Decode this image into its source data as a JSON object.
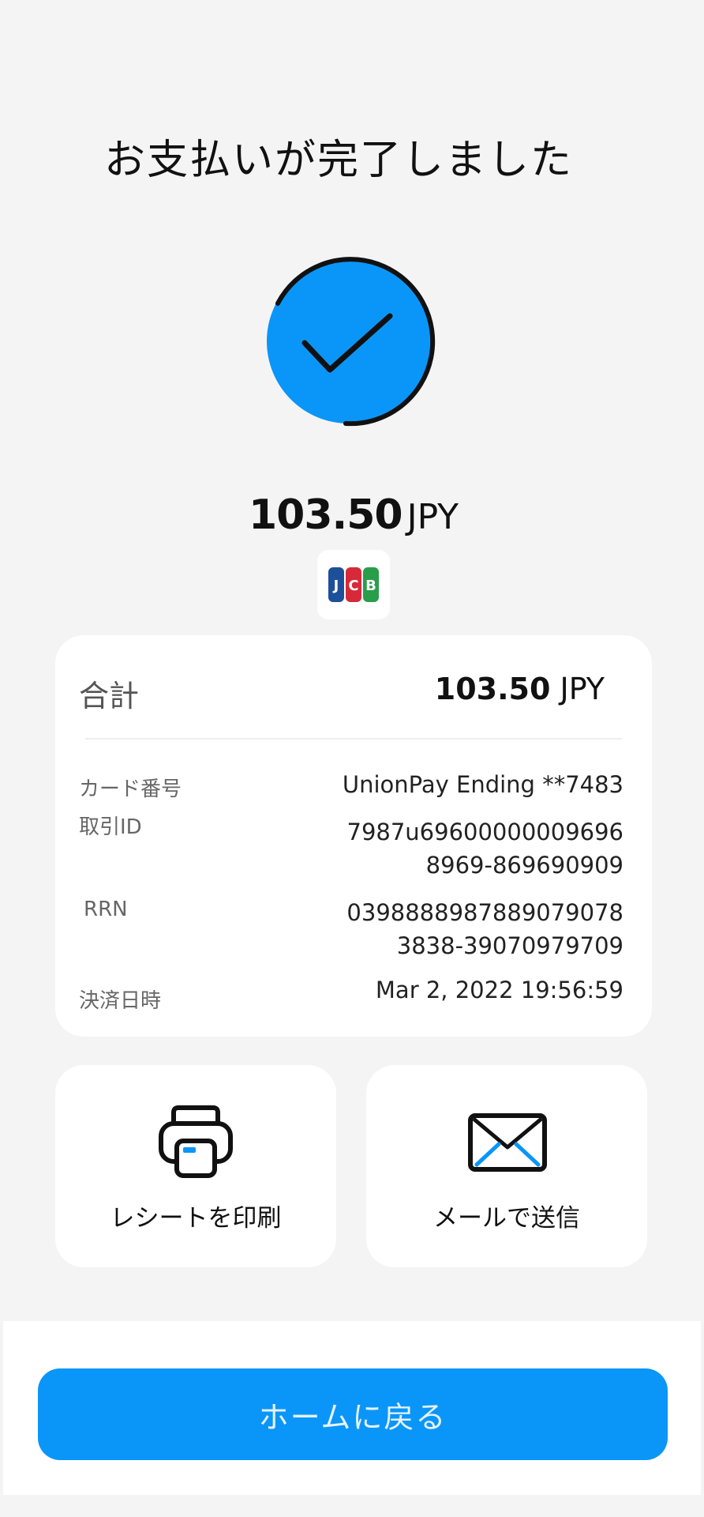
{
  "header": {
    "title": "お支払いが完了しました"
  },
  "status": {
    "icon": "check-circle-icon",
    "accent": "#0a96f8"
  },
  "amount": {
    "value": "103.50",
    "currency": "JPY"
  },
  "card_brand": {
    "icon": "jcb-logo",
    "text": "JCB"
  },
  "details": {
    "total_label": "合計",
    "total_value": "103.50",
    "total_currency": "JPY",
    "rows": [
      {
        "label": "カード番号",
        "lines": [
          "UnionPay Ending **7483"
        ]
      },
      {
        "label": "取引ID",
        "lines": [
          "7987u69600000009696",
          "8969-869690909"
        ]
      },
      {
        "label": "RRN",
        "lines": [
          "0398888987889079078",
          "3838-39070979709"
        ]
      },
      {
        "label": "決済日時",
        "lines": [
          "Mar 2, 2022 19:56:59"
        ]
      }
    ]
  },
  "actions": {
    "print": {
      "label": "レシートを印刷",
      "icon": "printer-icon"
    },
    "email": {
      "label": "メールで送信",
      "icon": "envelope-icon"
    }
  },
  "footer": {
    "home_button_label": "ホームに戻る"
  }
}
